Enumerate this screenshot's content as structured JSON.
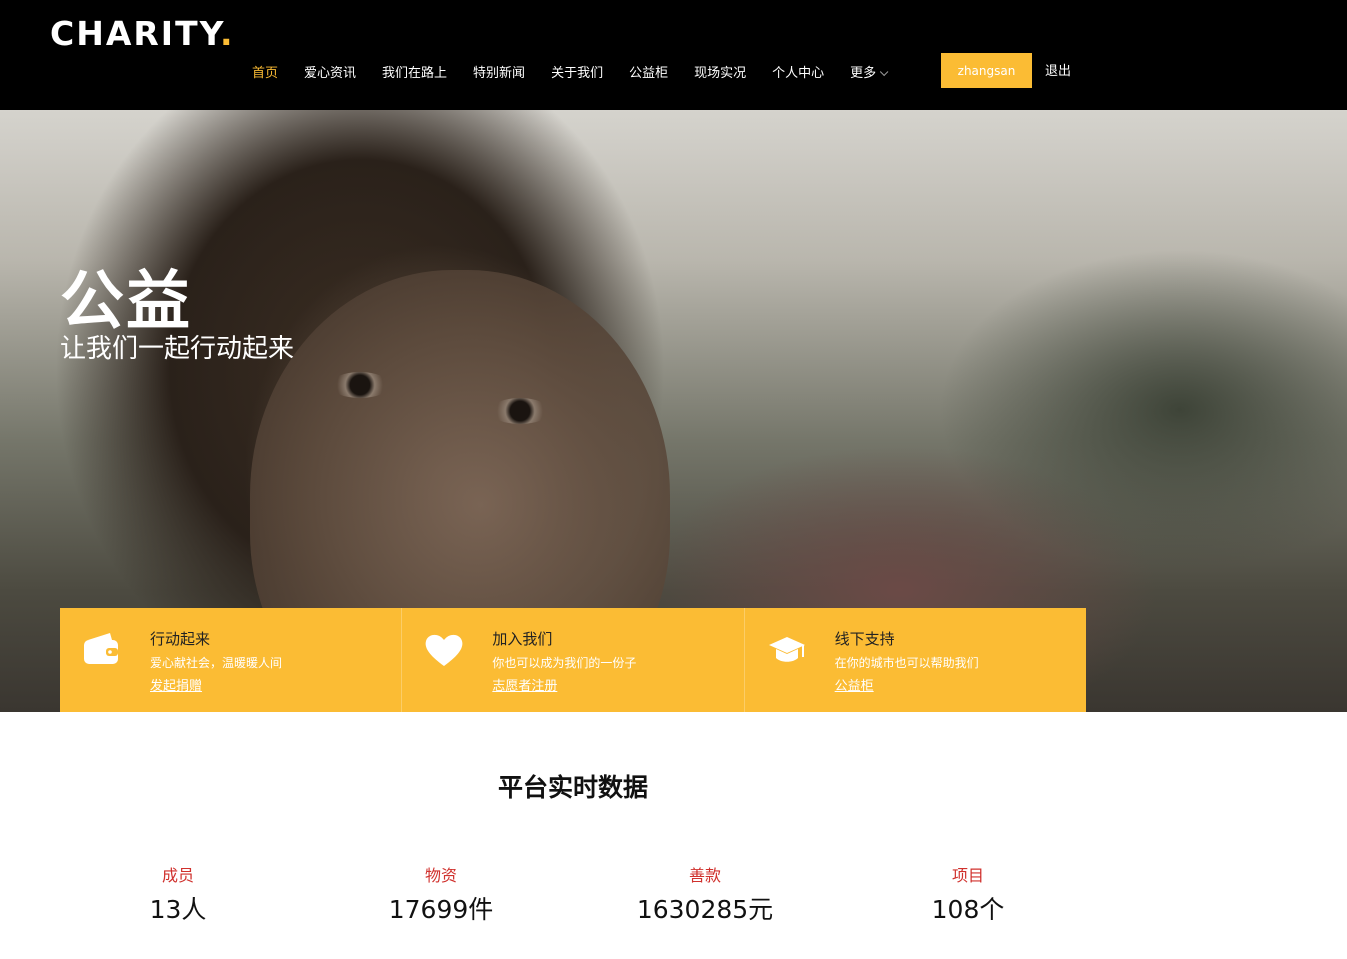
{
  "header": {
    "logo_text": "CHARITY",
    "logo_dot": ".",
    "nav": [
      {
        "label": "首页",
        "active": true
      },
      {
        "label": "爱心资讯"
      },
      {
        "label": "我们在路上"
      },
      {
        "label": "特别新闻"
      },
      {
        "label": "关于我们"
      },
      {
        "label": "公益柜"
      },
      {
        "label": "现场实况"
      },
      {
        "label": "个人中心"
      },
      {
        "label": "更多"
      }
    ],
    "user_button": "zhangsan",
    "logout": "退出"
  },
  "hero": {
    "title": "公益",
    "subtitle": "让我们一起行动起来"
  },
  "features": [
    {
      "icon": "wallet-icon",
      "title": "行动起来",
      "desc": "爱心献社会，温暖暖人间",
      "link": "发起捐赠"
    },
    {
      "icon": "heart-icon",
      "title": "加入我们",
      "desc": "你也可以成为我们的一份子",
      "link": "志愿者注册"
    },
    {
      "icon": "graduation-cap-icon",
      "title": "线下支持",
      "desc": "在你的城市也可以帮助我们",
      "link": "公益柜"
    }
  ],
  "stats": {
    "title": "平台实时数据",
    "items": [
      {
        "label": "成员",
        "value": "13人"
      },
      {
        "label": "物资",
        "value": "17699件"
      },
      {
        "label": "善款",
        "value": "1630285元"
      },
      {
        "label": "项目",
        "value": "108个"
      }
    ]
  },
  "colors": {
    "accent": "#fbbc34",
    "header_bg": "#000000",
    "stat_label": "#d0312d"
  }
}
